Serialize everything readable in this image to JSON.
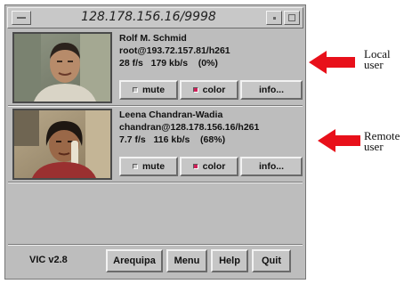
{
  "window": {
    "title": "128.178.156.16/9998"
  },
  "participants": [
    {
      "name": "Rolf M. Schmid",
      "address": "root@193.72.157.81/h261",
      "stats": "28 f/s   179 kb/s    (0%)",
      "mute_label": "mute",
      "color_label": "color",
      "info_label": "info..."
    },
    {
      "name": "Leena Chandran-Wadia",
      "address": "chandran@128.178.156.16/h261",
      "stats": "7.7 f/s   116 kb/s    (68%)",
      "mute_label": "mute",
      "color_label": "color",
      "info_label": "info..."
    }
  ],
  "bottom": {
    "version": "VIC v2.8",
    "arequipa_label": "Arequipa",
    "menu_label": "Menu",
    "help_label": "Help",
    "quit_label": "Quit"
  },
  "annotations": {
    "local_line1": "Local",
    "local_line2": "user",
    "remote_line1": "Remote",
    "remote_line2": "user"
  },
  "colors": {
    "arrow": "#e8101a",
    "color_indicator": "#d0205a",
    "window_bg": "#bdbdbd"
  }
}
